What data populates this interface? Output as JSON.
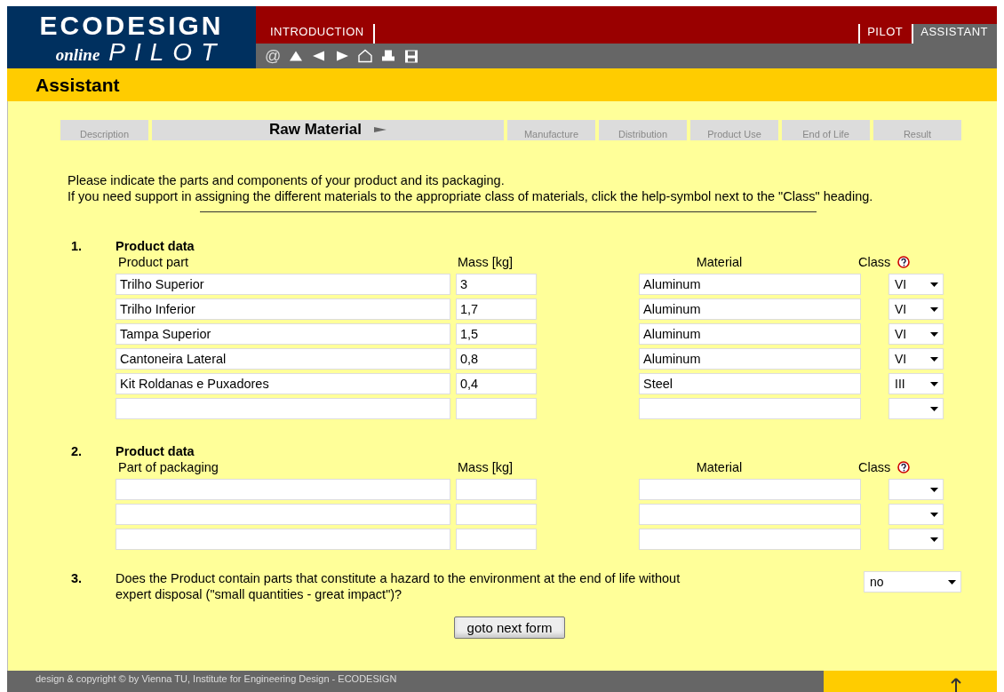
{
  "logo": {
    "title": "ECODESIGN",
    "subtitle_script": "online",
    "subtitle": "PILOT"
  },
  "nav_left": [
    {
      "label": "INTRODUCTION",
      "selected": false
    }
  ],
  "nav_right": [
    {
      "label": "PILOT",
      "selected": false
    },
    {
      "label": "ASSISTANT",
      "selected": true
    }
  ],
  "toolbar": [
    {
      "kind": "at",
      "glyph": "@"
    },
    {
      "kind": "up"
    },
    {
      "kind": "back"
    },
    {
      "kind": "forward"
    },
    {
      "kind": "home"
    },
    {
      "kind": "print"
    },
    {
      "kind": "save"
    }
  ],
  "page_title": "Assistant",
  "steps": [
    {
      "label": "Description",
      "selected": false
    },
    {
      "label": "Raw Material",
      "selected": true
    },
    {
      "label": "Manufacture",
      "selected": false
    },
    {
      "label": "Distribution",
      "selected": false
    },
    {
      "label": "Product Use",
      "selected": false
    },
    {
      "label": "End of Life",
      "selected": false
    },
    {
      "label": "Result",
      "selected": false
    }
  ],
  "intro": [
    "Please indicate the parts and components of your product and its packaging.",
    "If you need support in assigning the different materials to the appropriate class of materials, click the help-symbol next to the \"Class\" heading."
  ],
  "sections": [
    {
      "number": "1.",
      "title": "Product data",
      "columns": [
        "Product part",
        "Mass [kg]",
        "Material",
        "Class"
      ],
      "rows": [
        {
          "part": "Trilho Superior",
          "mass": "3",
          "material": "Aluminum",
          "class": "VI"
        },
        {
          "part": "Trilho Inferior",
          "mass": "1,7",
          "material": "Aluminum",
          "class": "VI"
        },
        {
          "part": "Tampa Superior",
          "mass": "1,5",
          "material": "Aluminum",
          "class": "VI"
        },
        {
          "part": "Cantoneira Lateral",
          "mass": "0,8",
          "material": "Aluminum",
          "class": "VI"
        },
        {
          "part": "Kit Roldanas e Puxadores",
          "mass": "0,4",
          "material": "Steel",
          "class": "III"
        },
        {}
      ]
    },
    {
      "number": "2.",
      "title": "Product data",
      "columns": [
        "Part of packaging",
        "Mass [kg]",
        "Material",
        "Class"
      ],
      "rows": [
        {},
        {},
        {}
      ]
    }
  ],
  "question": {
    "number": "3.",
    "text": "Does the Product contain parts that constitute a hazard to the environment at the end of life without expert disposal (\"small quantities - great impact\")?",
    "answer": "no"
  },
  "next_button": "goto next form",
  "footer": "design & copyright © by Vienna TU, Institute for Engineering Design - ECODESIGN"
}
